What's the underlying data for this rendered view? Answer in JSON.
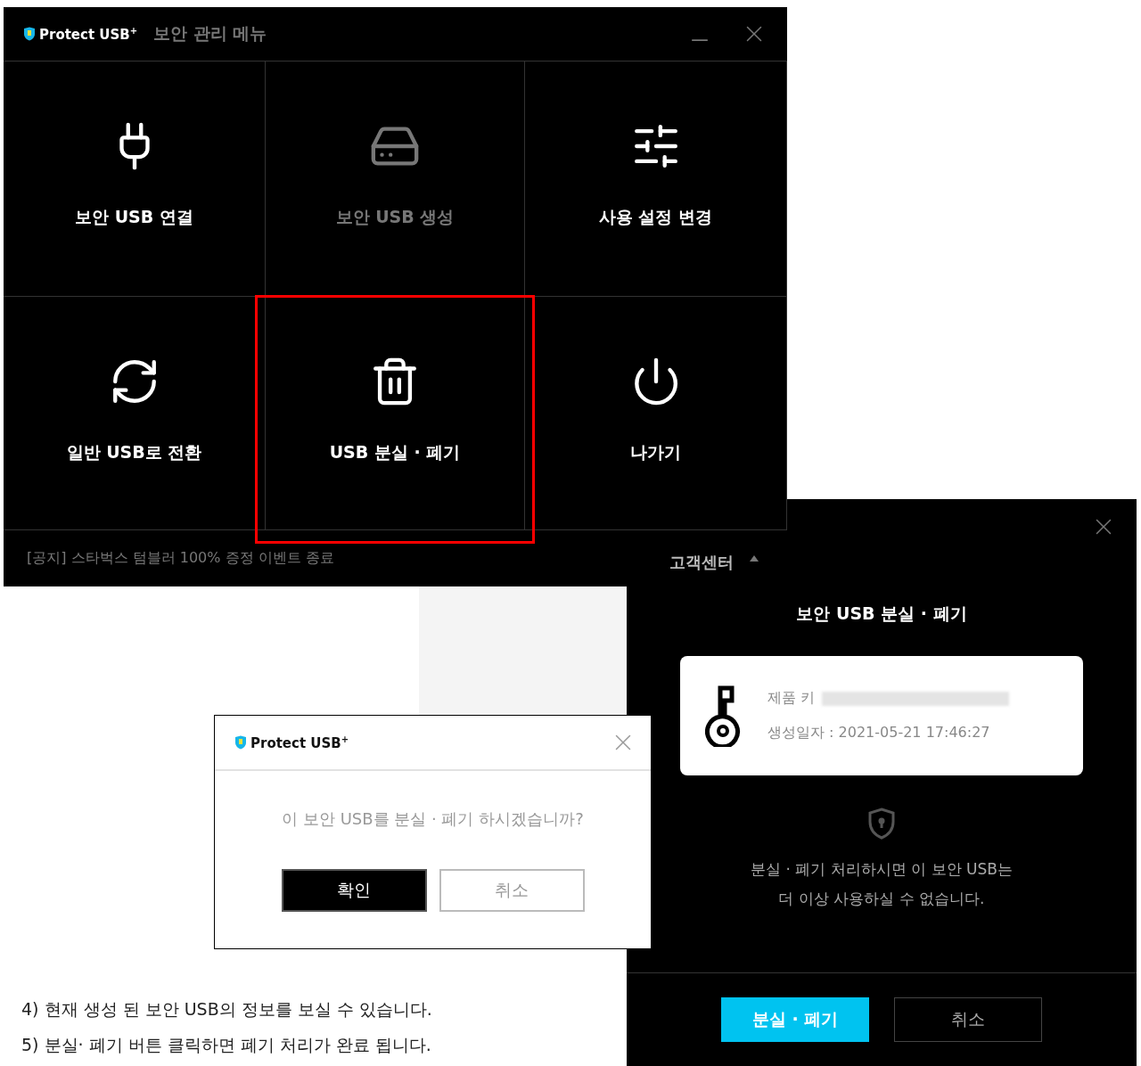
{
  "main_window": {
    "logo_text": "Protect USB$^{+}$",
    "title": "보안 관리 메뉴",
    "tiles": [
      {
        "label": "보안 USB 연결",
        "disabled": false,
        "highlighted": false
      },
      {
        "label": "보안 USB 생성",
        "disabled": true,
        "highlighted": false
      },
      {
        "label": "사용 설정 변경",
        "disabled": false,
        "highlighted": false
      },
      {
        "label": "일반 USB로 전환",
        "disabled": false,
        "highlighted": false
      },
      {
        "label": "USB 분실 · 폐기",
        "disabled": false,
        "highlighted": true
      },
      {
        "label": "나가기",
        "disabled": false,
        "highlighted": false
      }
    ],
    "notice": "[공지] 스타벅스 텀블러 100% 증정 이벤트 종료",
    "support": "고객센터"
  },
  "loss_panel": {
    "title": "보안 USB 분실 · 폐기",
    "key_label": "제품 키",
    "created": "생성일자 : 2021-05-21 17:46:27",
    "warning": [
      "분실 · 폐기 처리하시면 이 보안 USB는",
      "더 이상 사용하실 수 없습니다."
    ],
    "buttons": [
      {
        "label": "분실 · 폐기",
        "primary": true
      },
      {
        "label": "취소",
        "primary": false
      }
    ]
  },
  "confirm_dialog": {
    "logo_text": "Protect USB$^{+}$",
    "message": "이 보안 USB를 분실 · 폐기 하시겠습니까?",
    "buttons": [
      {
        "label": "확인",
        "primary": true
      },
      {
        "label": "취소",
        "primary": false
      }
    ]
  },
  "instructions": [
    "4) 현재 생성 된 보안 USB의 정보를 보실 수 있습니다.",
    "5) 분실· 폐기 버튼 클릭하면 폐기 처리가 완료 됩니다."
  ]
}
